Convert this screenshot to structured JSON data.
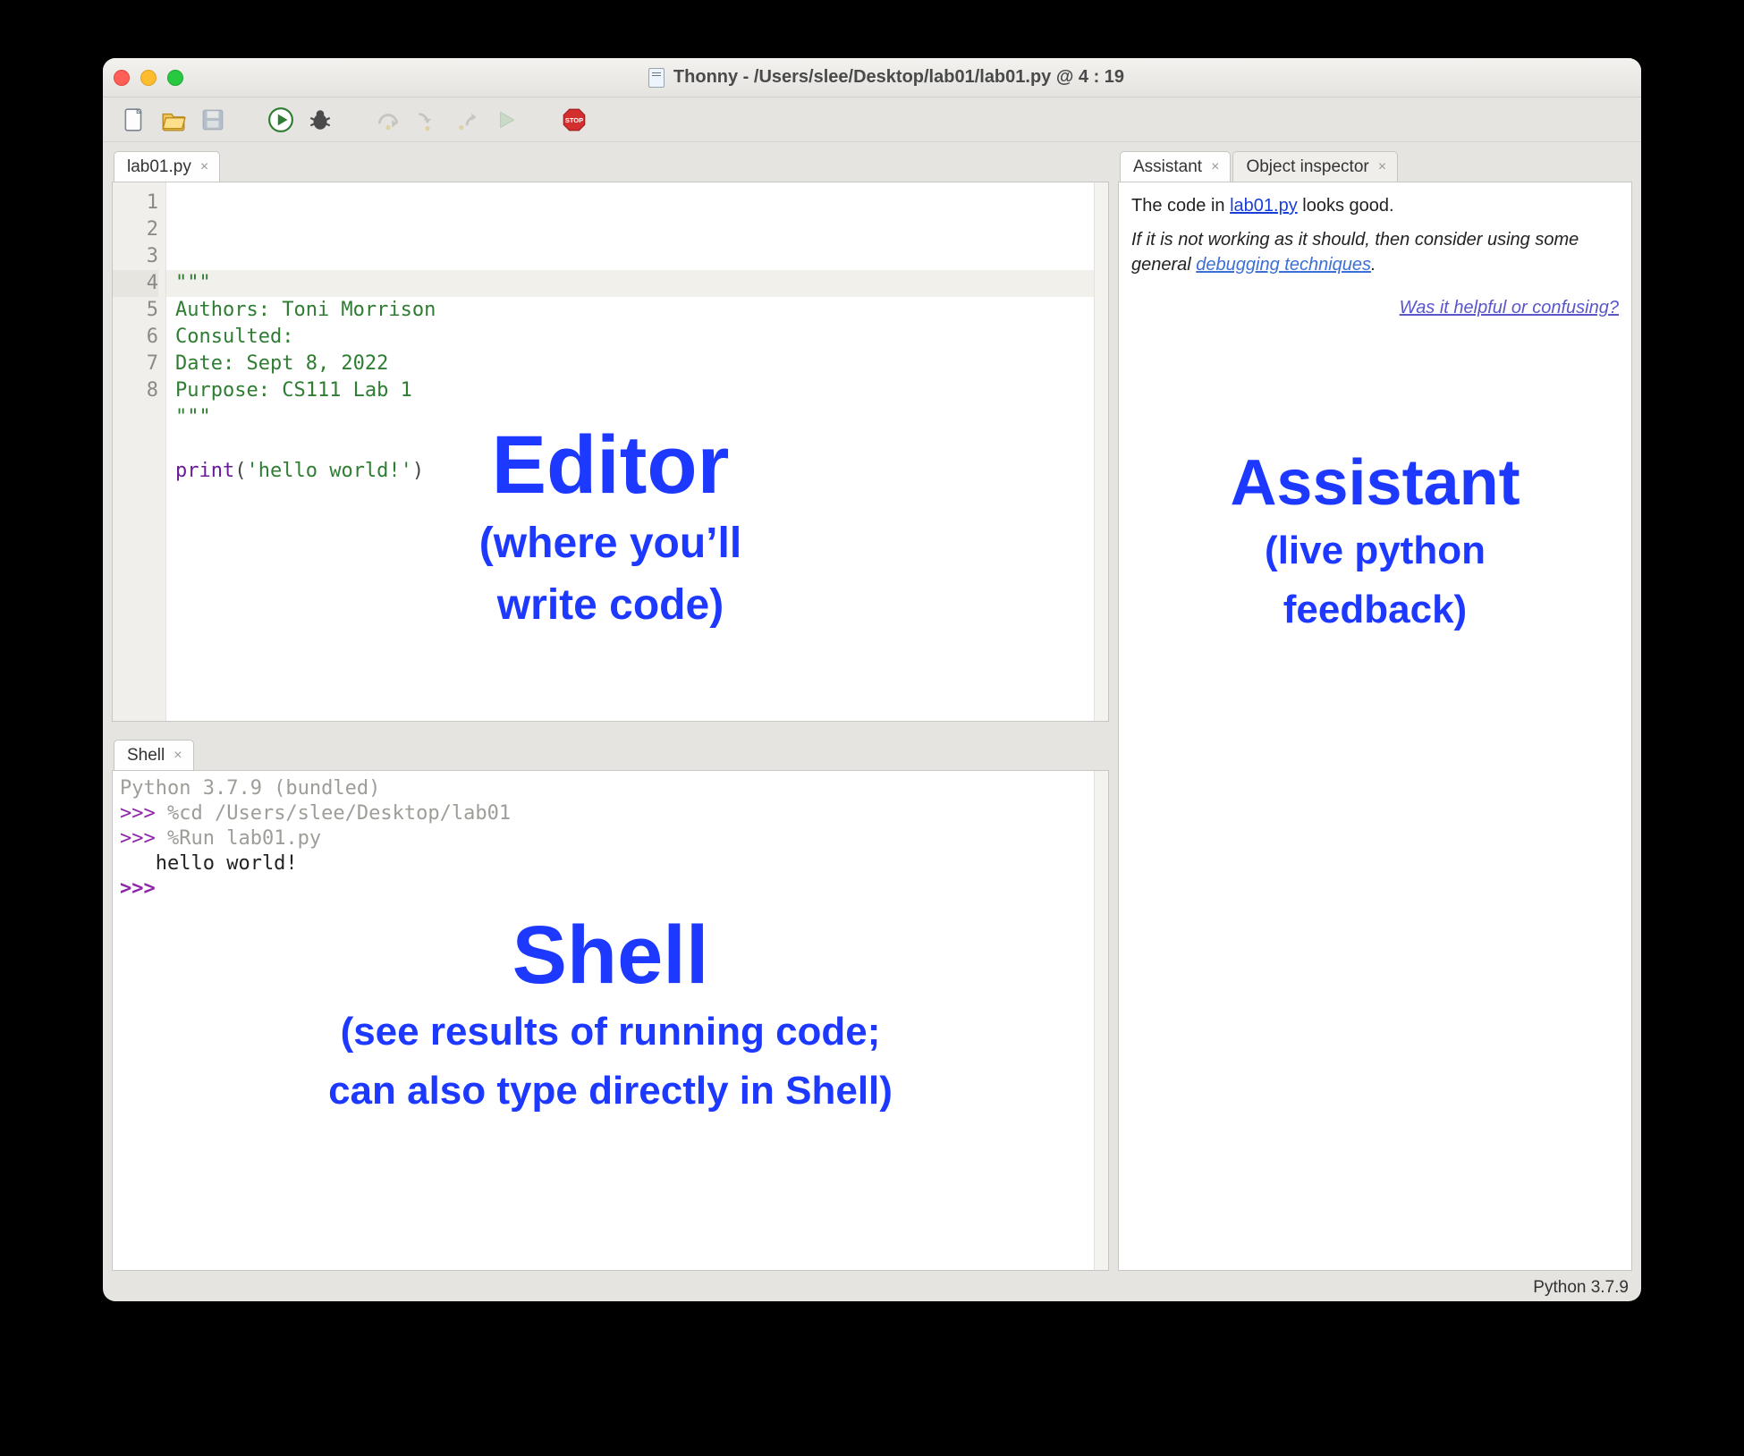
{
  "window": {
    "title": "Thonny  -  /Users/slee/Desktop/lab01/lab01.py  @  4 : 19"
  },
  "toolbar": {
    "new": "New",
    "open": "Open",
    "save": "Save",
    "run": "Run",
    "debug": "Debug",
    "step_over": "Step over",
    "step_into": "Step into",
    "step_out": "Step out",
    "resume": "Resume",
    "stop": "Stop"
  },
  "editor": {
    "tab_label": "lab01.py",
    "line_numbers": [
      "1",
      "2",
      "3",
      "4",
      "5",
      "6",
      "7",
      "8"
    ],
    "highlight_line": 4,
    "lines": [
      {
        "tokens": [
          {
            "cls": "tok-str",
            "text": "\"\"\""
          }
        ]
      },
      {
        "tokens": [
          {
            "cls": "tok-str",
            "text": "Authors: Toni Morrison"
          }
        ]
      },
      {
        "tokens": [
          {
            "cls": "tok-str",
            "text": "Consulted:"
          }
        ]
      },
      {
        "tokens": [
          {
            "cls": "tok-str",
            "text": "Date: Sept 8, 2022"
          }
        ]
      },
      {
        "tokens": [
          {
            "cls": "tok-str",
            "text": "Purpose: CS111 Lab 1"
          }
        ]
      },
      {
        "tokens": [
          {
            "cls": "tok-str",
            "text": "\"\"\""
          }
        ]
      },
      {
        "tokens": [
          {
            "cls": "tok-plain",
            "text": ""
          }
        ]
      },
      {
        "tokens": [
          {
            "cls": "tok-func",
            "text": "print"
          },
          {
            "cls": "tok-paren",
            "text": "("
          },
          {
            "cls": "tok-str",
            "text": "'hello world!'"
          },
          {
            "cls": "tok-paren",
            "text": ")"
          }
        ]
      }
    ]
  },
  "shell": {
    "tab_label": "Shell",
    "version_line": "Python 3.7.9 (bundled)",
    "lines": [
      {
        "prompt": ">>> ",
        "cmd": "%cd /Users/slee/Desktop/lab01"
      },
      {
        "prompt": ">>> ",
        "cmd": "%Run lab01.py"
      }
    ],
    "output_indent": "   ",
    "output": "hello world!",
    "current_prompt": ">>> "
  },
  "assistant": {
    "tabs": [
      {
        "label": "Assistant",
        "active": true
      },
      {
        "label": "Object inspector",
        "active": false
      }
    ],
    "intro_pre": "The code in ",
    "intro_link": "lab01.py",
    "intro_post": " looks good.",
    "advice_pre": "If it is not working as it should, then consider using some general ",
    "advice_link": "debugging techniques",
    "advice_post": ".",
    "feedback_link": "Was it helpful or confusing?"
  },
  "statusbar": {
    "python_version": "Python 3.7.9"
  },
  "annotations": {
    "editor": {
      "title": "Editor",
      "sub1": "(where you’ll",
      "sub2": "write code)"
    },
    "shell": {
      "title": "Shell",
      "sub1": "(see results of running code;",
      "sub2": "can also type directly in Shell)"
    },
    "assistant": {
      "title": "Assistant",
      "sub1": "(live python",
      "sub2": "feedback)"
    }
  }
}
